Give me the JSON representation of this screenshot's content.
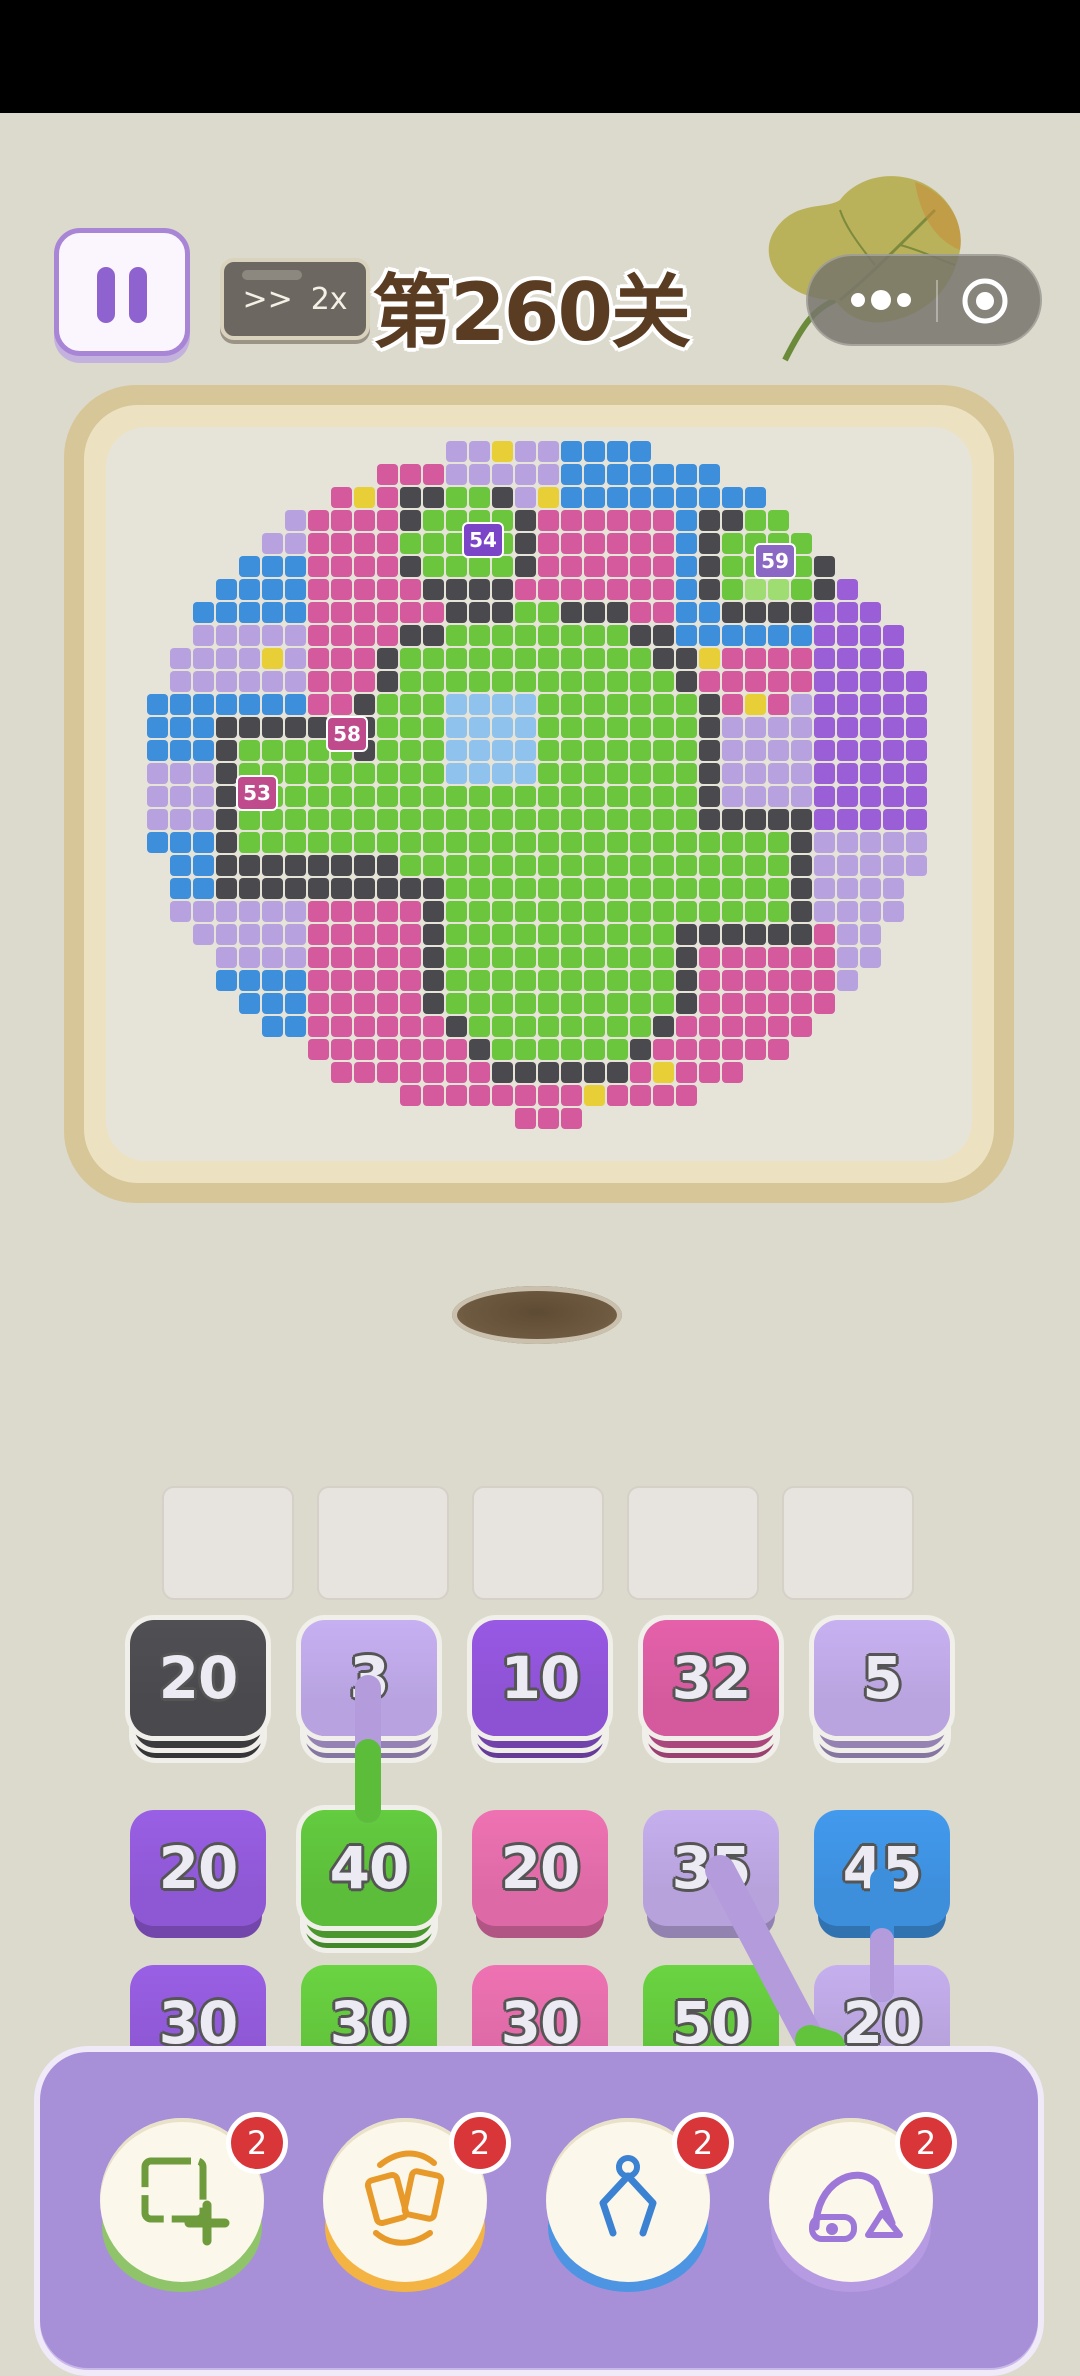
{
  "header": {
    "speed_arrows": ">>",
    "speed_label": "2x",
    "level_title": "第260关"
  },
  "puzzle": {
    "markers": [
      "54",
      "59",
      "58",
      "53"
    ]
  },
  "slots_count": 5,
  "tiles": [
    {
      "value": "20",
      "color": "#4a4a4e"
    },
    {
      "value": "3",
      "color": "#b8a3e0"
    },
    {
      "value": "10",
      "color": "#8d52d3"
    },
    {
      "value": "32",
      "color": "#d45a9d"
    },
    {
      "value": "5",
      "color": "#b9a4df"
    },
    {
      "value": "20",
      "color": "#8e58d4"
    },
    {
      "value": "40",
      "color": "#5cbd3a"
    },
    {
      "value": "20",
      "color": "#dd6aa6"
    },
    {
      "value": "35",
      "color": "#b7a2dc"
    },
    {
      "value": "45",
      "color": "#3d8fdc"
    },
    {
      "value": "30",
      "color": "#8e58d4"
    },
    {
      "value": "30",
      "color": "#62c43c"
    },
    {
      "value": "30",
      "color": "#dd6aa6"
    },
    {
      "value": "50",
      "color": "#62c43c"
    },
    {
      "value": "20",
      "color": "#b7a2dc"
    }
  ],
  "boosters": [
    {
      "name": "add-slot",
      "icon": "add-slot-icon",
      "count": "2",
      "base_color": "#8fc46a"
    },
    {
      "name": "shuffle",
      "icon": "shuffle-icon",
      "count": "2",
      "base_color": "#f4b444"
    },
    {
      "name": "grab",
      "icon": "claw-icon",
      "count": "2",
      "base_color": "#4d95e2"
    },
    {
      "name": "vacuum",
      "icon": "vacuum-icon",
      "count": "2",
      "base_color": "#b69be3"
    }
  ]
}
